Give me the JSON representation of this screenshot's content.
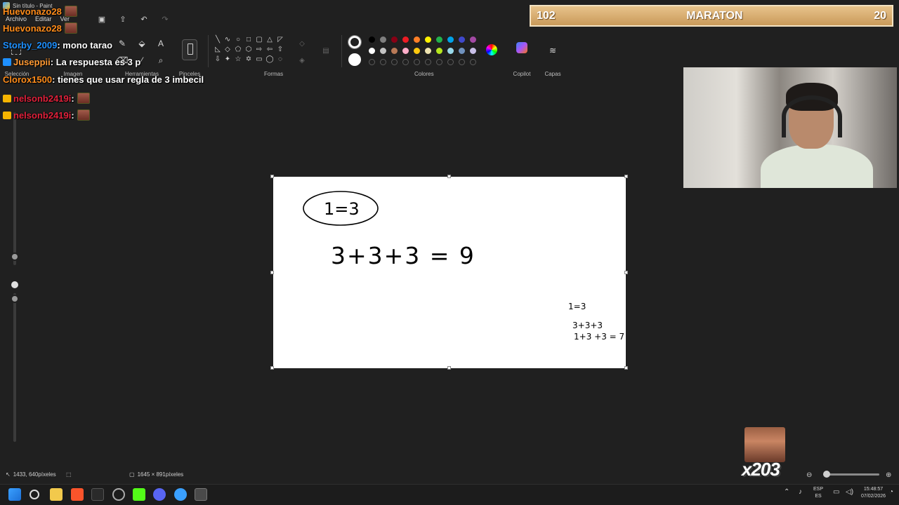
{
  "window": {
    "title": "Sin título - Paint"
  },
  "menu": {
    "file": "Archivo",
    "edit": "Editar",
    "view": "Ver"
  },
  "ribbon": {
    "groups": {
      "selection": "Selección",
      "image": "Imagen",
      "tools": "Herramientas",
      "brushes": "Pinceles",
      "shapes": "Formas",
      "colors": "Colores",
      "copilot": "Copilot",
      "layers": "Capas"
    },
    "palette_row1": [
      "#000000",
      "#7f7f7f",
      "#880015",
      "#ed1c24",
      "#ff7f27",
      "#fff200",
      "#22b14c",
      "#00a2e8",
      "#3f48cc",
      "#a349a4"
    ],
    "palette_row2": [
      "#ffffff",
      "#c3c3c3",
      "#b97a57",
      "#ffaec9",
      "#ffc90e",
      "#efe4b0",
      "#b5e61d",
      "#99d9ea",
      "#7092be",
      "#c8bfe7"
    ],
    "color1": "#000000",
    "color2": "#ffffff"
  },
  "chat": [
    {
      "user": "Huevonazo28",
      "user_color": "#ff8c1a",
      "message": "",
      "badge": "none"
    },
    {
      "user": "Huevonazo28",
      "user_color": "#ff8c1a",
      "message": "",
      "badge": "none"
    },
    {
      "user": "Storby_2009",
      "user_color": "#1e90ff",
      "message": " : mono tarao",
      "badge": "none"
    },
    {
      "user": "Juseppii",
      "user_color": "#ff9933",
      "message": " : La respuesta es 3 p",
      "badge": "sub"
    },
    {
      "user": "Clorox1500",
      "user_color": "#ff8c1a",
      "message": " : tienes que usar regla de 3 imbecil",
      "badge": "none"
    },
    {
      "user": "nelsonb2419i",
      "user_color": "#e0213b",
      "message": " :",
      "badge": "crown"
    },
    {
      "user": "nelsonb2419i",
      "user_color": "#e0213b",
      "message": " :",
      "badge": "crown"
    }
  ],
  "drawing": {
    "circled": "1=3",
    "equation": "3+3+3 = 9",
    "note1": "1=3",
    "note2": "3+3+3",
    "note3": "1+3 +3 = 7"
  },
  "overlay": {
    "left": "102",
    "center": "MARATON",
    "right": "20"
  },
  "combo": "x203",
  "status": {
    "cursor": "1433, 640píxeles",
    "canvas_size": "1645 × 891píxeles"
  },
  "tray": {
    "lang_top": "ESP",
    "lang_bottom": "ES",
    "time": "15:48:57",
    "date": "07/02/2026"
  }
}
